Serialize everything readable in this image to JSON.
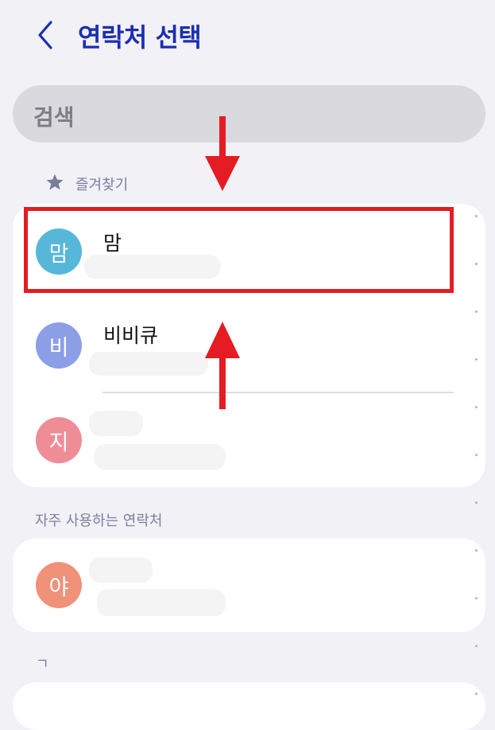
{
  "header": {
    "title": "연락처 선택",
    "back_icon": "chevron-left-icon"
  },
  "search": {
    "label": "검색"
  },
  "favorites": {
    "label": "즐겨찾기",
    "icon": "star-icon",
    "contacts": [
      {
        "initial": "맘",
        "name": "맘",
        "color": "#57b7d8"
      },
      {
        "initial": "비",
        "name": "비비큐",
        "color": "#8c9ee6"
      },
      {
        "initial": "지",
        "name": "",
        "color": "#ef8d97"
      }
    ]
  },
  "frequent": {
    "label": "자주 사용하는 연락처",
    "contacts": [
      {
        "initial": "야",
        "name": "",
        "color": "#f0917a"
      }
    ]
  },
  "index_section": {
    "label": "ㄱ"
  },
  "colors": {
    "title": "#1c2fb0",
    "highlight": "#e51c23",
    "background": "#f1f1f6"
  }
}
